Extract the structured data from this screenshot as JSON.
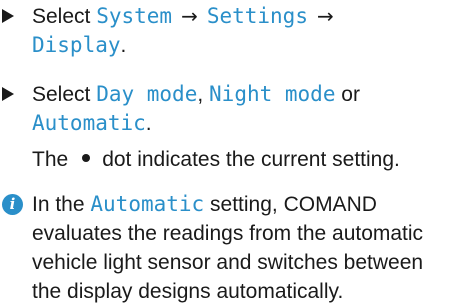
{
  "steps": [
    {
      "prefix": "Select ",
      "ui_items": [
        "System",
        "Settings",
        "Display"
      ],
      "separator": "→",
      "suffix": "."
    },
    {
      "prefix": "Select ",
      "ui_items": [
        "Day mode",
        "Night mode",
        "Automatic"
      ],
      "joiner_1": ", ",
      "joiner_2": " or",
      "suffix": "."
    }
  ],
  "result": {
    "before": "The",
    "after": "dot indicates the current setting."
  },
  "note": {
    "icon": "info-icon",
    "prefix": "In the ",
    "ui_item": "Automatic",
    "line_1_rest": " setting, COMAND",
    "line_2": "evaluates the readings from the automatic",
    "line_3": "vehicle light sensor and switches between",
    "line_4": "the display designs automatically."
  },
  "colors": {
    "ui_text": "#2a8fc9",
    "body_text": "#1a1a1a",
    "icon_bg": "#2a8fc9"
  }
}
